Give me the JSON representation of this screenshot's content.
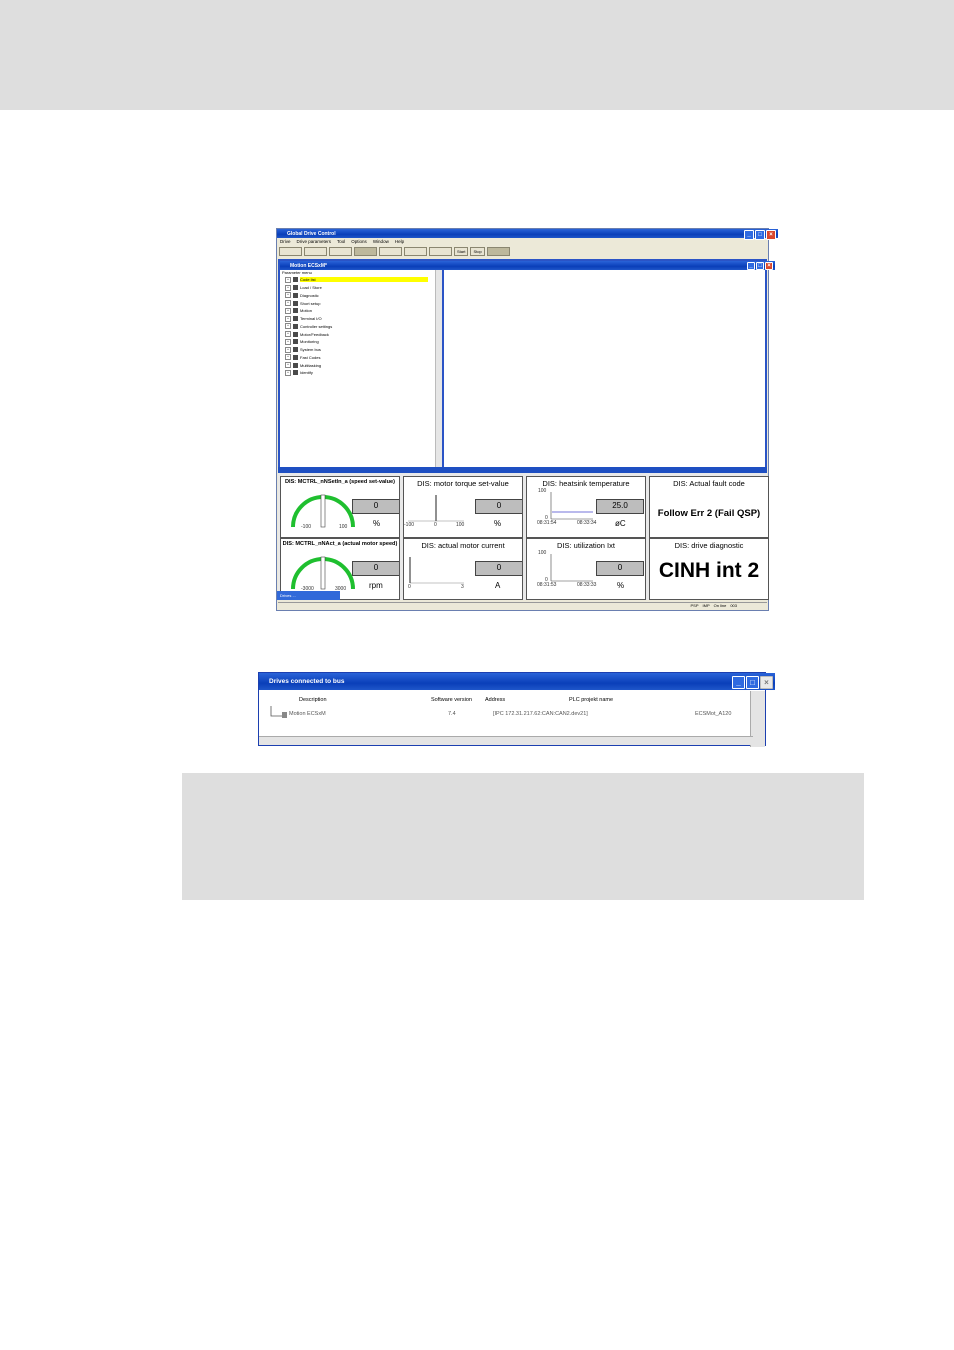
{
  "app": {
    "title": "Global Drive Control",
    "menu": [
      "Drive",
      "Drive parameters",
      "Tool",
      "Options",
      "Window",
      "Help"
    ],
    "toolbar": {
      "start": "Start",
      "stop": "Stop"
    }
  },
  "child": {
    "title": "Motion ECSxM*",
    "tree_header": "Parameter menu",
    "tree_items": [
      "Code list",
      "Load / Store",
      "Diagnostic",
      "Short setup",
      "Motion",
      "Terminal I/O",
      "Controller settings",
      "Motor/Feedback",
      "Monitoring",
      "System bus",
      "Fast Codes",
      "Multitasking",
      "Identify"
    ],
    "selected_index": 0
  },
  "monitor": {
    "p1": {
      "title": "DIS: MCTRL_nNSetIn_a (speed set-value)",
      "value": "0",
      "unit": "%",
      "min": "-100",
      "max": "100"
    },
    "p2": {
      "title": "DIS: motor torque set-value",
      "value": "0",
      "unit": "%",
      "ticks": [
        "-100",
        "0",
        "100"
      ]
    },
    "p3": {
      "title": "DIS: heatsink temperature",
      "value": "25.0",
      "unit": "øC",
      "ymax": "100",
      "ymin": "0",
      "t0": "08:31:54",
      "t1": "08:33:34"
    },
    "p4": {
      "title": "DIS: Actual fault code",
      "text": "Follow Err 2 (Fail QSP)"
    },
    "p5": {
      "title": "DIS: MCTRL_nNAct_a (actual motor speed)",
      "value": "0",
      "unit": "rpm",
      "min": "-3000",
      "max": "3000"
    },
    "p6": {
      "title": "DIS: actual motor current",
      "value": "0",
      "unit": "A",
      "ticks": [
        "0",
        "3"
      ]
    },
    "p7": {
      "title": "DIS: utilization Ixt",
      "value": "0",
      "unit": "%",
      "ymax": "100",
      "ymin": "0",
      "t0": "08:31:53",
      "t1": "08:33:33"
    },
    "p8": {
      "title": "DIS: drive diagnostic",
      "text": "CINH int 2"
    }
  },
  "status": {
    "items": [
      "PSP",
      "IMP",
      "On line",
      "003"
    ]
  },
  "taskbar": {
    "label": "Drives ..."
  },
  "drives": {
    "title": "Drives connected to bus",
    "columns": [
      "Description",
      "Software version",
      "Address",
      "PLC projekt name"
    ],
    "row": {
      "description": "Motion ECSxM",
      "version": "7.4",
      "address": "[IPC 172.31.217.62:CAN:CAN2.dev21]",
      "plc": "ECSMot_A120"
    }
  },
  "colors": {
    "title_blue": "#0a3fb9",
    "highlight": "#ffff00",
    "gauge": "#1fbf2f",
    "trend": "#4444cc"
  }
}
